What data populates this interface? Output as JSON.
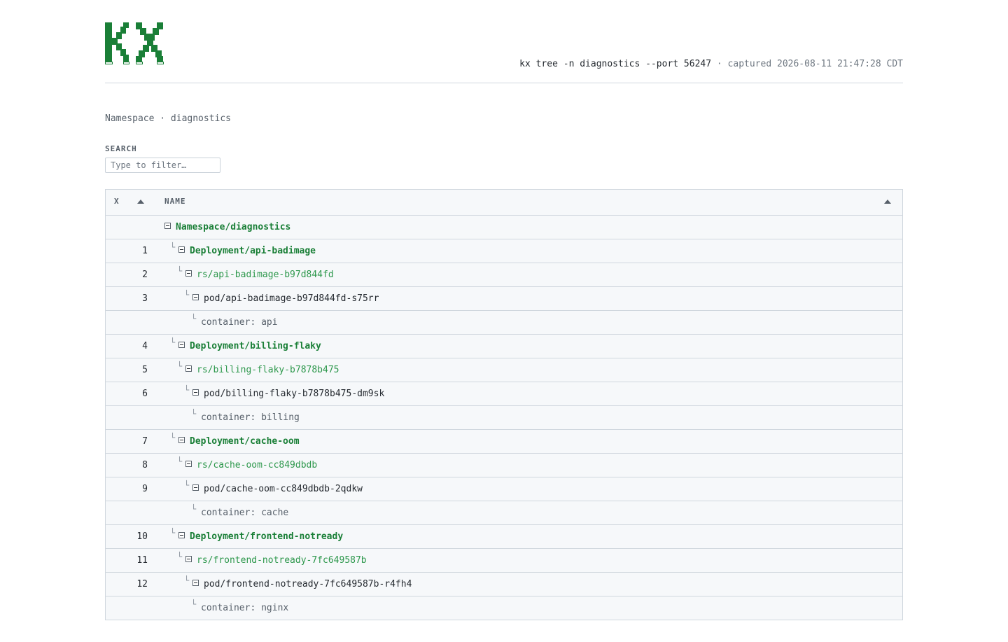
{
  "header": {
    "logo_text": "kx",
    "command": "kx tree -n diagnostics --port 56247",
    "separator": "·",
    "captured": "captured 2026-08-11 21:47:28 CDT"
  },
  "namespace_line": "Namespace · diagnostics",
  "search": {
    "label": "SEARCH",
    "placeholder": "Type to filter…",
    "value": ""
  },
  "table": {
    "col_x": "X",
    "col_name": "NAME",
    "rows": [
      {
        "x": "",
        "name": "Namespace/diagnostics",
        "level": 0,
        "toggle": true
      },
      {
        "x": "1",
        "name": "Deployment/api-badimage",
        "level": 1,
        "toggle": true
      },
      {
        "x": "2",
        "name": "rs/api-badimage-b97d844fd",
        "level": 2,
        "toggle": true
      },
      {
        "x": "3",
        "name": "pod/api-badimage-b97d844fd-s75rr",
        "level": 3,
        "toggle": true
      },
      {
        "x": "",
        "name": "container: api",
        "level": 4,
        "toggle": false
      },
      {
        "x": "4",
        "name": "Deployment/billing-flaky",
        "level": 1,
        "toggle": true
      },
      {
        "x": "5",
        "name": "rs/billing-flaky-b7878b475",
        "level": 2,
        "toggle": true
      },
      {
        "x": "6",
        "name": "pod/billing-flaky-b7878b475-dm9sk",
        "level": 3,
        "toggle": true
      },
      {
        "x": "",
        "name": "container: billing",
        "level": 4,
        "toggle": false
      },
      {
        "x": "7",
        "name": "Deployment/cache-oom",
        "level": 1,
        "toggle": true
      },
      {
        "x": "8",
        "name": "rs/cache-oom-cc849dbdb",
        "level": 2,
        "toggle": true
      },
      {
        "x": "9",
        "name": "pod/cache-oom-cc849dbdb-2qdkw",
        "level": 3,
        "toggle": true
      },
      {
        "x": "",
        "name": "container: cache",
        "level": 4,
        "toggle": false
      },
      {
        "x": "10",
        "name": "Deployment/frontend-notready",
        "level": 1,
        "toggle": true
      },
      {
        "x": "11",
        "name": "rs/frontend-notready-7fc649587b",
        "level": 2,
        "toggle": true
      },
      {
        "x": "12",
        "name": "pod/frontend-notready-7fc649587b-r4fh4",
        "level": 3,
        "toggle": true
      },
      {
        "x": "",
        "name": "container: nginx",
        "level": 4,
        "toggle": false
      }
    ]
  },
  "colors": {
    "accent": "#1a7f37",
    "accent_light": "#2c974b"
  },
  "icons": {
    "toggle": "collapse-icon",
    "sort": "sort-up-icon",
    "branch": "tree-branch-icon"
  }
}
